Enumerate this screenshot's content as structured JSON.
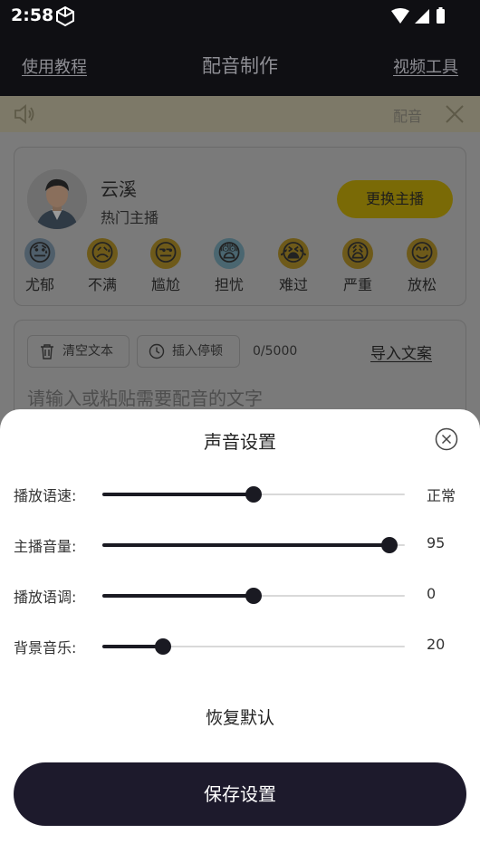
{
  "status_bar": {
    "time": "2:58"
  },
  "header": {
    "left_link": "使用教程",
    "title": "配音制作",
    "right_link": "视频工具"
  },
  "notice": {
    "text": "配音"
  },
  "voice": {
    "name": "云溪",
    "tag": "热门主播",
    "change_button": "更换主播"
  },
  "emotions": [
    {
      "label": "尤郁",
      "icon": "depressed-face"
    },
    {
      "label": "不满",
      "icon": "dissatisfied-face"
    },
    {
      "label": "尴尬",
      "icon": "awkward-face"
    },
    {
      "label": "担忧",
      "icon": "worried-face"
    },
    {
      "label": "难过",
      "icon": "crying-face"
    },
    {
      "label": "严重",
      "icon": "serious-face"
    },
    {
      "label": "放松",
      "icon": "relaxed-face"
    }
  ],
  "text_editor": {
    "clear_button": "清空文本",
    "insert_pause_button": "插入停顿",
    "char_count": "0/5000",
    "import_link": "导入文案",
    "placeholder": "请输入或粘贴需要配音的文字"
  },
  "sound_settings": {
    "title": "声音设置",
    "rows": [
      {
        "label": "播放语速:",
        "value": "正常",
        "level": 0.5
      },
      {
        "label": "主播音量:",
        "value": "95",
        "level": 0.95
      },
      {
        "label": "播放语调:",
        "value": "0",
        "level": 0.5
      },
      {
        "label": "背景音乐:",
        "value": "20",
        "level": 0.2
      }
    ],
    "reset_button": "恢复默认",
    "save_button": "保存设置"
  },
  "colors": {
    "dark": "#1a1a22",
    "accent": "#f5d50a",
    "track": "#d9d9d9"
  }
}
